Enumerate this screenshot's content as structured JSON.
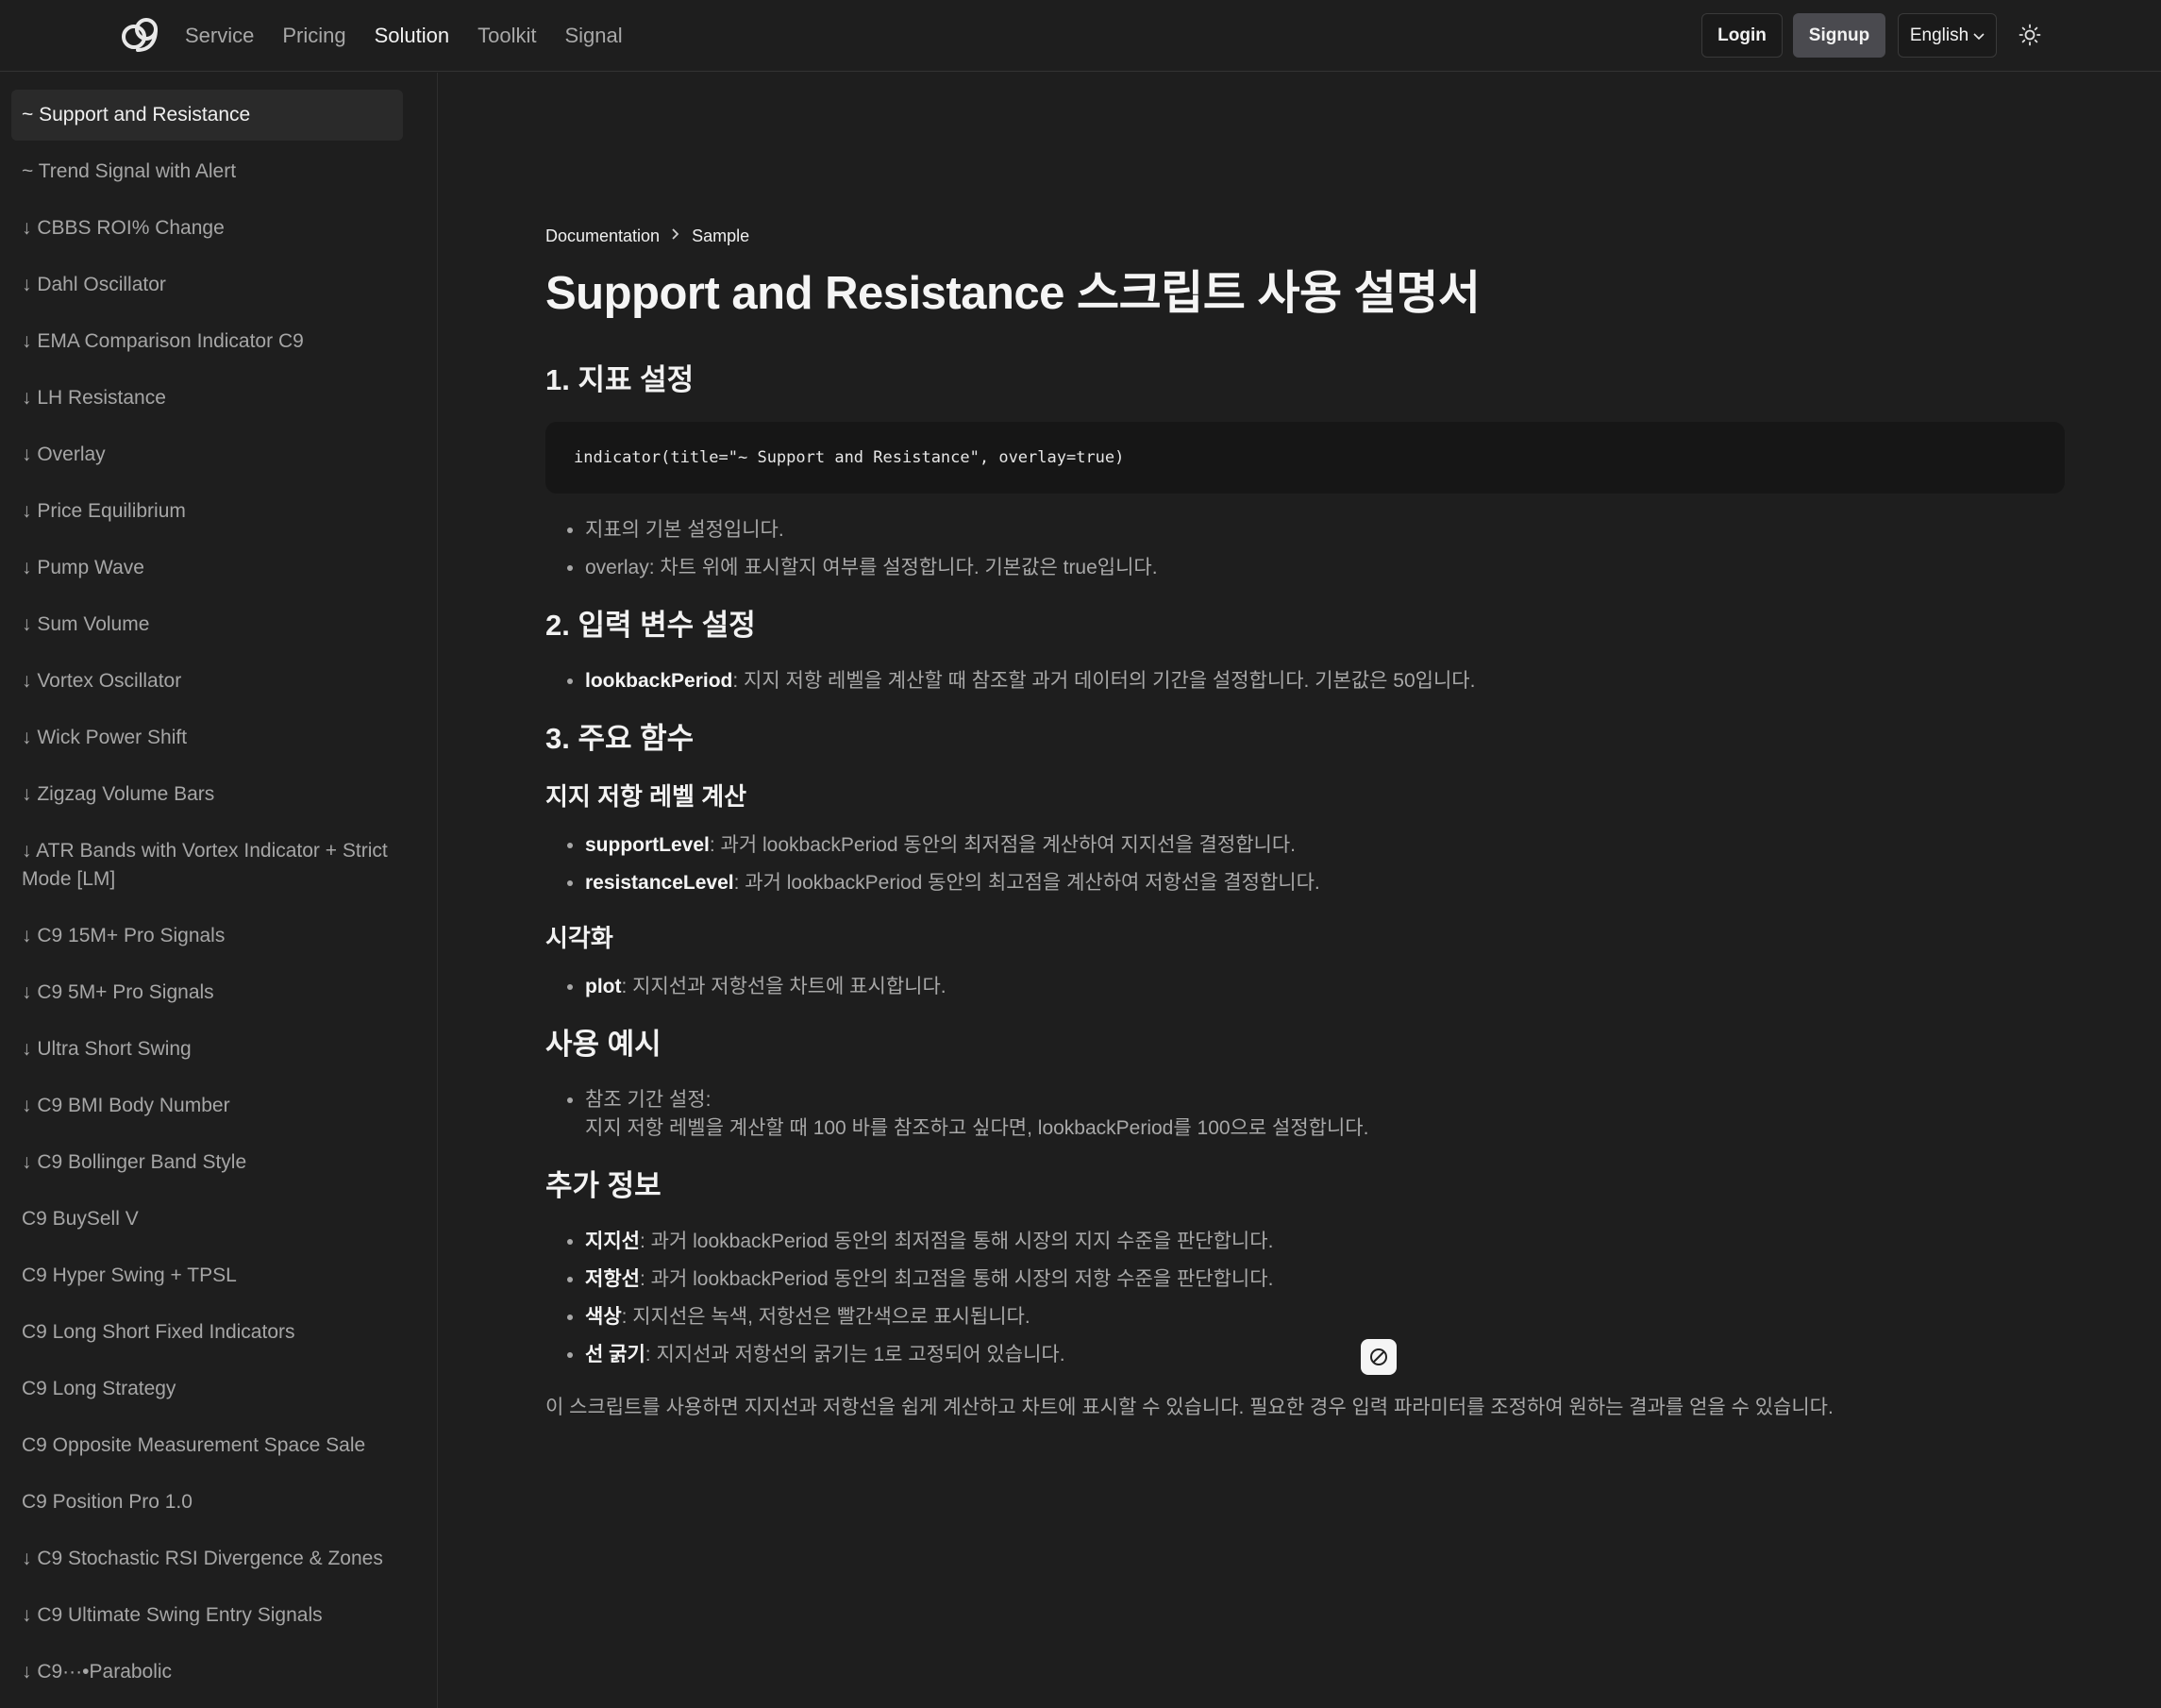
{
  "nav": {
    "links": [
      "Service",
      "Pricing",
      "Solution",
      "Toolkit",
      "Signal"
    ],
    "active": "Solution",
    "login": "Login",
    "signup": "Signup",
    "language": "English"
  },
  "sidebar": {
    "items": [
      "~ Support and Resistance",
      "~ Trend Signal with Alert",
      "↓ CBBS ROI% Change",
      "↓ Dahl Oscillator",
      "↓ EMA Comparison Indicator C9",
      "↓ LH Resistance",
      "↓ Overlay",
      "↓ Price Equilibrium",
      "↓ Pump Wave",
      "↓ Sum Volume",
      "↓ Vortex Oscillator",
      "↓ Wick Power Shift",
      "↓ Zigzag Volume Bars",
      "↓ ATR Bands with Vortex Indicator + Strict Mode [LM]",
      "↓ C9 15M+ Pro Signals",
      "↓ C9 5M+ Pro Signals",
      "↓ Ultra Short Swing",
      "↓ C9 BMI Body Number",
      "↓ C9 Bollinger Band Style",
      "C9 BuySell V",
      "C9 Hyper Swing + TPSL",
      "C9 Long Short Fixed Indicators",
      "C9 Long Strategy",
      "C9 Opposite Measurement Space Sale",
      "C9 Position Pro 1.0",
      "↓ C9 Stochastic RSI Divergence & Zones",
      "↓ C9 Ultimate Swing Entry Signals",
      "↓ C9···•Parabolic"
    ]
  },
  "doc": {
    "breadcrumb": [
      "Documentation",
      "Sample"
    ],
    "title": "Support and Resistance 스크립트 사용 설명서",
    "s1": {
      "heading": "1. 지표 설정",
      "code": "indicator(title=\"~ Support and Resistance\", overlay=true)",
      "bullets": [
        "지표의 기본 설정입니다.",
        "overlay: 차트 위에 표시할지 여부를 설정합니다. 기본값은 true입니다."
      ]
    },
    "s2": {
      "heading": "2. 입력 변수 설정",
      "b1_term": "lookbackPeriod",
      "b1_text": ": 지지 저항 레벨을 계산할 때 참조할 과거 데이터의 기간을 설정합니다. 기본값은 50입니다."
    },
    "s3": {
      "heading": "3. 주요 함수",
      "sub1": "지지 저항 레벨 계산",
      "b1_term": "supportLevel",
      "b1_text": ": 과거 lookbackPeriod 동안의 최저점을 계산하여 지지선을 결정합니다.",
      "b2_term": "resistanceLevel",
      "b2_text": ": 과거 lookbackPeriod 동안의 최고점을 계산하여 저항선을 결정합니다.",
      "sub2": "시각화",
      "b3_term": "plot",
      "b3_text": ": 지지선과 저항선을 차트에 표시합니다."
    },
    "s4": {
      "heading": "사용 예시",
      "line1": "참조 기간 설정:",
      "line2": "지지 저항 레벨을 계산할 때 100 바를 참조하고 싶다면, lookbackPeriod를 100으로 설정합니다."
    },
    "s5": {
      "heading": "추가 정보",
      "b1_term": "지지선",
      "b1_text": ": 과거 lookbackPeriod 동안의 최저점을 통해 시장의 지지 수준을 판단합니다.",
      "b2_term": "저항선",
      "b2_text": ": 과거 lookbackPeriod 동안의 최고점을 통해 시장의 저항 수준을 판단합니다.",
      "b3_term": "색상",
      "b3_text": ": 지지선은 녹색, 저항선은 빨간색으로 표시됩니다.",
      "b4_term": "선 굵기",
      "b4_text": ": 지지선과 저항선의 굵기는 1로 고정되어 있습니다."
    },
    "closing": "이 스크립트를 사용하면 지지선과 저항선을 쉽게 계산하고 차트에 표시할 수 있습니다. 필요한 경우 입력 파라미터를 조정하여 원하는 결과를 얻을 수 있습니다."
  },
  "icons": {
    "logo": "c9-logo-icon",
    "theme": "sun-icon",
    "lang_caret": "chevron-down-icon",
    "breadcrumb_sep": "chevron-right-icon",
    "floating": "prohibited-icon"
  }
}
